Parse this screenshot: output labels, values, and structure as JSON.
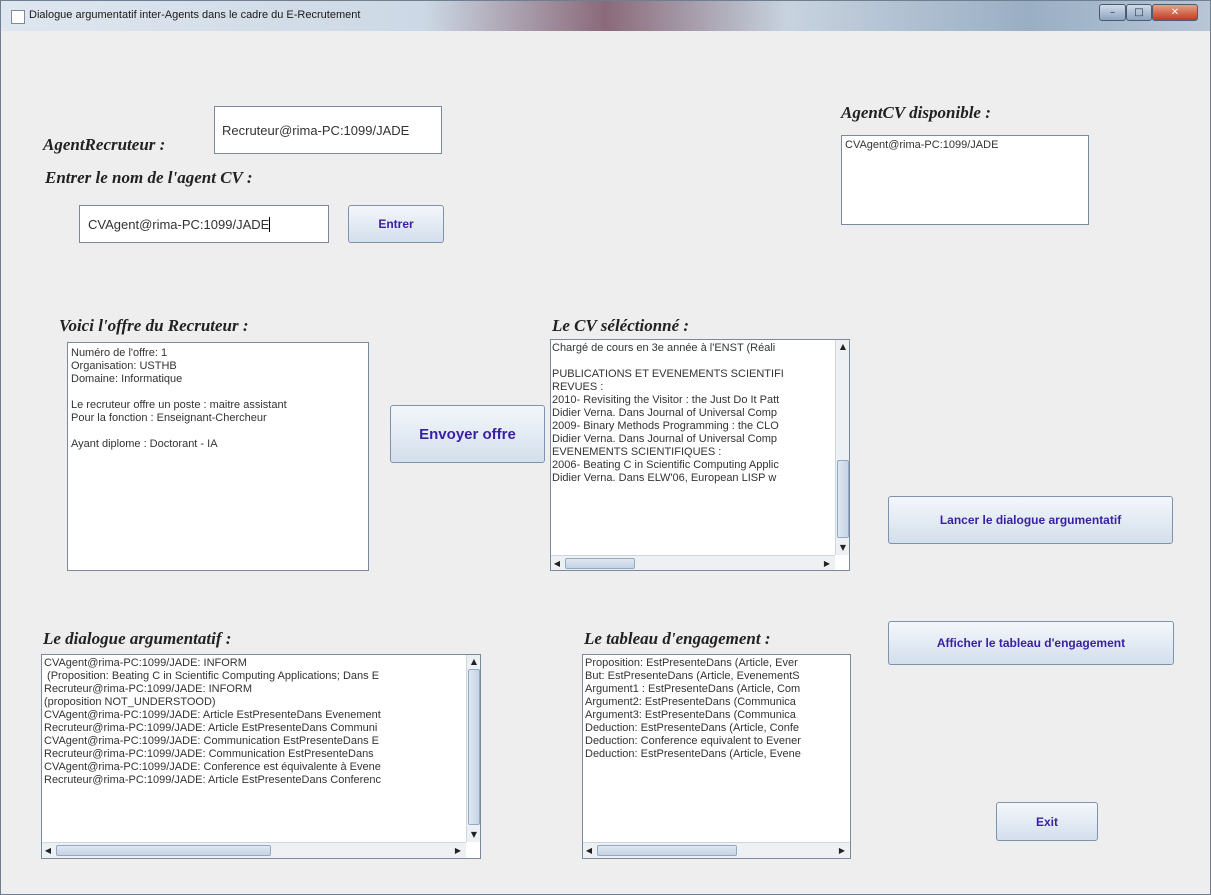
{
  "window": {
    "title": "Dialogue argumentatif inter-Agents dans le cadre du E-Recrutement"
  },
  "recruiter": {
    "label": "AgentRecruteur :",
    "value": "Recruteur@rima-PC:1099/JADE"
  },
  "agent_cv_available": {
    "label": "AgentCV disponible :",
    "items": [
      "CVAgent@rima-PC:1099/JADE"
    ]
  },
  "cv_name": {
    "label": "Entrer le nom de l'agent CV :",
    "value": "CVAgent@rima-PC:1099/JADE",
    "button": "Entrer"
  },
  "offer": {
    "label": "Voici l'offre du Recruteur :",
    "lines": [
      "Numéro de l'offre: 1",
      "Organisation: USTHB",
      "Domaine: Informatique",
      "",
      "Le recruteur offre un poste : maitre assistant",
      "Pour la fonction : Enseignant-Chercheur",
      "",
      "Ayant diplome : Doctorant - IA"
    ],
    "send_button": "Envoyer offre"
  },
  "cv": {
    "label": "Le CV séléctionné :",
    "lines": [
      "Chargé de cours en 3e année à l'ENST (Réali",
      "",
      "PUBLICATIONS ET EVENEMENTS SCIENTIFI",
      "REVUES :",
      "2010- Revisiting the Visitor : the Just Do It Patt",
      "Didier Verna. Dans Journal of Universal Comp",
      "2009- Binary Methods Programming : the CLO",
      "Didier Verna. Dans Journal of Universal Comp",
      "EVENEMENTS SCIENTIFIQUES :",
      "2006- Beating C in Scientific Computing Applic",
      "Didier Verna. Dans ELW'06, European LISP w"
    ]
  },
  "actions": {
    "launch_dialogue": "Lancer le dialogue argumentatif",
    "show_commitment": "Afficher le tableau d'engagement",
    "exit": "Exit"
  },
  "dialogue": {
    "label": "Le dialogue argumentatif :",
    "lines": [
      "CVAgent@rima-PC:1099/JADE: INFORM",
      " (Proposition: Beating C in Scientific Computing Applications; Dans E",
      "Recruteur@rima-PC:1099/JADE: INFORM",
      "(proposition NOT_UNDERSTOOD)",
      "CVAgent@rima-PC:1099/JADE: Article EstPresenteDans Evenement",
      "Recruteur@rima-PC:1099/JADE: Article EstPresenteDans Communi",
      "CVAgent@rima-PC:1099/JADE: Communication EstPresenteDans E",
      "Recruteur@rima-PC:1099/JADE: Communication EstPresenteDans",
      "CVAgent@rima-PC:1099/JADE: Conference est équivalente à Evene",
      "Recruteur@rima-PC:1099/JADE: Article EstPresenteDans Conferenc"
    ]
  },
  "commitment": {
    "label": "Le tableau d'engagement :",
    "lines": [
      "Proposition: EstPresenteDans (Article, Ever",
      "But: EstPresenteDans (Article, EvenementS",
      "Argument1 : EstPresenteDans (Article, Com",
      "Argument2: EstPresenteDans (Communica",
      "Argument3: EstPresenteDans (Communica",
      "Deduction: EstPresenteDans (Article, Confe",
      "Deduction: Conference equivalent to Evener",
      "Deduction: EstPresenteDans (Article, Evene"
    ]
  },
  "scroll": {
    "up": "▲",
    "down": "▼",
    "left": "◀",
    "right": "▶"
  },
  "icons": {
    "minimize": "minimize-icon",
    "maximize": "maximize-icon",
    "close": "close-icon",
    "app": "app-icon"
  },
  "colors": {
    "button_text": "#3a1fa3",
    "window_bg": "#eeeeee"
  }
}
